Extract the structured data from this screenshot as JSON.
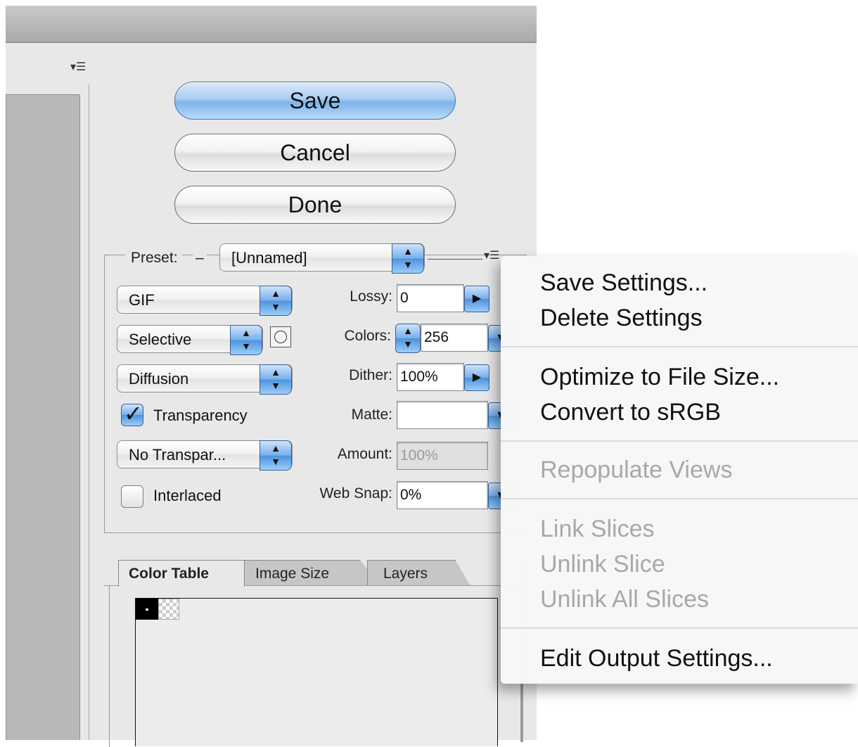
{
  "buttons": {
    "save": "Save",
    "cancel": "Cancel",
    "done": "Done"
  },
  "preset": {
    "label": "Preset:",
    "dash": "–",
    "value": "[Unnamed]"
  },
  "settings": {
    "format": "GIF",
    "palette": "Selective",
    "dither_algorithm": "Diffusion",
    "transparency_dither": "No Transpar...",
    "lossy_label": "Lossy:",
    "lossy_value": "0",
    "colors_label": "Colors:",
    "colors_value": "256",
    "dither_label": "Dither:",
    "dither_value": "100%",
    "matte_label": "Matte:",
    "matte_value": "",
    "amount_label": "Amount:",
    "amount_value": "100%",
    "websnap_label": "Web Snap:",
    "websnap_value": "0%",
    "transparency_label": "Transparency",
    "transparency_checked": true,
    "interlaced_label": "Interlaced",
    "interlaced_checked": false
  },
  "tabs": [
    {
      "label": "Color Table",
      "active": true
    },
    {
      "label": "Image Size",
      "active": false
    },
    {
      "label": "Layers",
      "active": false
    }
  ],
  "menu": {
    "save_settings": "Save Settings...",
    "delete_settings": "Delete Settings",
    "optimize": "Optimize to File Size...",
    "convert_srgb": "Convert to sRGB",
    "repopulate": "Repopulate Views",
    "link_slices": "Link Slices",
    "unlink_slice": "Unlink Slice",
    "unlink_all": "Unlink All Slices",
    "edit_output": "Edit Output Settings..."
  },
  "icons": {
    "panel_menu": "panel-menu-icon",
    "up_down_arrows": "updown-arrows-icon",
    "right_arrow": "right-arrow-icon",
    "checkmark": "checkmark-icon"
  }
}
